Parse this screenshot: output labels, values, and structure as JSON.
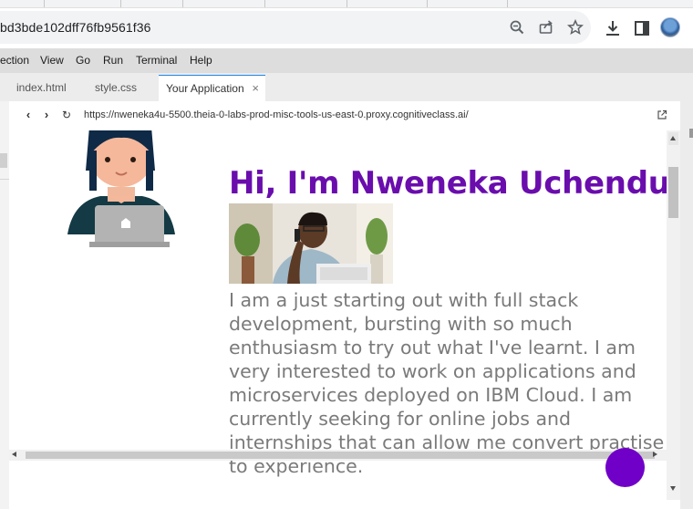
{
  "browser": {
    "url": "bd3bde102dff76fb9561f36",
    "icons": [
      "zoom-icon",
      "share-icon",
      "bookmark-star-icon",
      "download-icon",
      "side-panel-icon",
      "profile-avatar"
    ]
  },
  "menubar": {
    "items": [
      "ection",
      "View",
      "Go",
      "Run",
      "Terminal",
      "Help"
    ]
  },
  "tabs": [
    {
      "label": "index.html"
    },
    {
      "label": "style.css"
    },
    {
      "label": "Your Application",
      "close": "×",
      "active": true
    }
  ],
  "preview": {
    "url": "https://nweneka4u-5500.theia-0-labs-prod-misc-tools-us-east-0.proxy.cognitiveclass.ai/",
    "back": "‹",
    "forward": "›",
    "reload": "↻"
  },
  "page": {
    "heading": "Hi, I'm Nweneka Uchendu!",
    "bio": "I am a just starting out with full stack development, bursting with so much enthusiasm to try out what I've learnt. I am very interested to work on applications and microservices deployed on IBM Cloud. I am currently seeking for online jobs and internships that can allow me convert practise to experience."
  },
  "colors": {
    "heading": "#6a0dad",
    "bio_text": "#7a7a7a",
    "fab": "#7000c8",
    "active_tab_accent": "#1e88e5"
  }
}
